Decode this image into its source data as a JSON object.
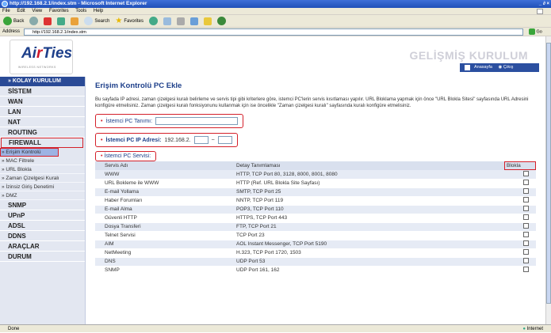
{
  "window": {
    "title": "http://192.168.2.1/index.stm - Microsoft Internet Explorer",
    "controls": "_ ∂ ×"
  },
  "menu": [
    "File",
    "Edit",
    "View",
    "Favorites",
    "Tools",
    "Help"
  ],
  "toolbar": {
    "back": "Back",
    "search": "Search",
    "favorites": "Favorites"
  },
  "address": {
    "label": "Address",
    "url": "http://192.168.2.1/index.stm",
    "go": "Go"
  },
  "header": {
    "logo_text_a": "Ai",
    "logo_text_r": "r",
    "logo_text_b": "Ties",
    "logo_sub": "WIRELESS NETWORKS",
    "title": "GELİŞMİŞ KURULUM",
    "home_link": "Anasayfa",
    "logout_link": "Çıkış"
  },
  "sidebar": {
    "head": "» KOLAY KURULUM",
    "items": [
      {
        "label": "SİSTEM",
        "type": "main"
      },
      {
        "label": "WAN",
        "type": "main"
      },
      {
        "label": "LAN",
        "type": "main"
      },
      {
        "label": "NAT",
        "type": "main"
      },
      {
        "label": "ROUTING",
        "type": "main"
      },
      {
        "label": "FIREWALL",
        "type": "main"
      },
      {
        "label": "» Erişim Kontrolü",
        "type": "sub"
      },
      {
        "label": "» MAC Filtrele",
        "type": "sub"
      },
      {
        "label": "» URL Blokla",
        "type": "sub"
      },
      {
        "label": "» Zaman Çizelgesi Kuralı",
        "type": "sub"
      },
      {
        "label": "» İzinsiz Giriş Denetimi",
        "type": "sub"
      },
      {
        "label": "» DMZ",
        "type": "sub"
      },
      {
        "label": "SNMP",
        "type": "main"
      },
      {
        "label": "UPnP",
        "type": "main"
      },
      {
        "label": "ADSL",
        "type": "main"
      },
      {
        "label": "DDNS",
        "type": "main"
      },
      {
        "label": "ARAÇLAR",
        "type": "main"
      },
      {
        "label": "DURUM",
        "type": "main"
      }
    ]
  },
  "main": {
    "title": "Erişim Kontrolü PC Ekle",
    "description": "Bu sayfada IP adresi, zaman çizelgesi kuralı belirleme ve servis tipi gibi kriterlere göre, istemci PC'lerin servis kısıtlaması yapılır. URL Bloklama yapmak için önce \"URL Blokla Sitesi\" sayfasında URL Adresini konfigüre etmelisiniz. Zaman çizelgesi kuralı fonksiyonunu kullanmak için ise öncelikle \"Zaman çizelgesi kuralı\" sayfasında kuralı konfigüre etmelisiniz.",
    "pc_name_label": "İstemci PC Tanımı:",
    "pc_ip_label": "İstemci PC IP Adresi:",
    "ip_prefix": "192.168.2.",
    "ip_sep": "~",
    "service_label": "İstemci PC Servisi:",
    "table_headers": [
      "Servis Adı",
      "Detay Tanımlaması",
      "Blokla"
    ],
    "services": [
      {
        "name": "WWW",
        "detail": "HTTP, TCP Port 80, 3128, 8000, 8001, 8080"
      },
      {
        "name": "URL Bokleme ile WWW",
        "detail": "HTTP (Ref. URL Blokla Site Sayfası)"
      },
      {
        "name": "E-mail Yollama",
        "detail": "SMTP, TCP Port 25"
      },
      {
        "name": "Haber Forumları",
        "detail": "NNTP, TCP Port 119"
      },
      {
        "name": "E-mail Alma",
        "detail": "POP3, TCP Port 110"
      },
      {
        "name": "Güvenli HTTP",
        "detail": "HTTPS, TCP Port 443"
      },
      {
        "name": "Dosya Transferi",
        "detail": "FTP, TCP Port 21"
      },
      {
        "name": "Telnet Servisi",
        "detail": "TCP Port 23"
      },
      {
        "name": "AIM",
        "detail": "AOL Instant Messenger, TCP Port 5190"
      },
      {
        "name": "NetMeeting",
        "detail": "H.323, TCP Port 1720, 1503"
      },
      {
        "name": "DNS",
        "detail": "UDP Port 53"
      },
      {
        "name": "SNMP",
        "detail": "UDP Port 161, 162"
      }
    ]
  },
  "status": {
    "left": "Done",
    "right": "Internet"
  },
  "colors": {
    "accent": "#1d3f8a",
    "highlight": "#d4202a",
    "sidebar_bg": "#e3e7f1"
  }
}
